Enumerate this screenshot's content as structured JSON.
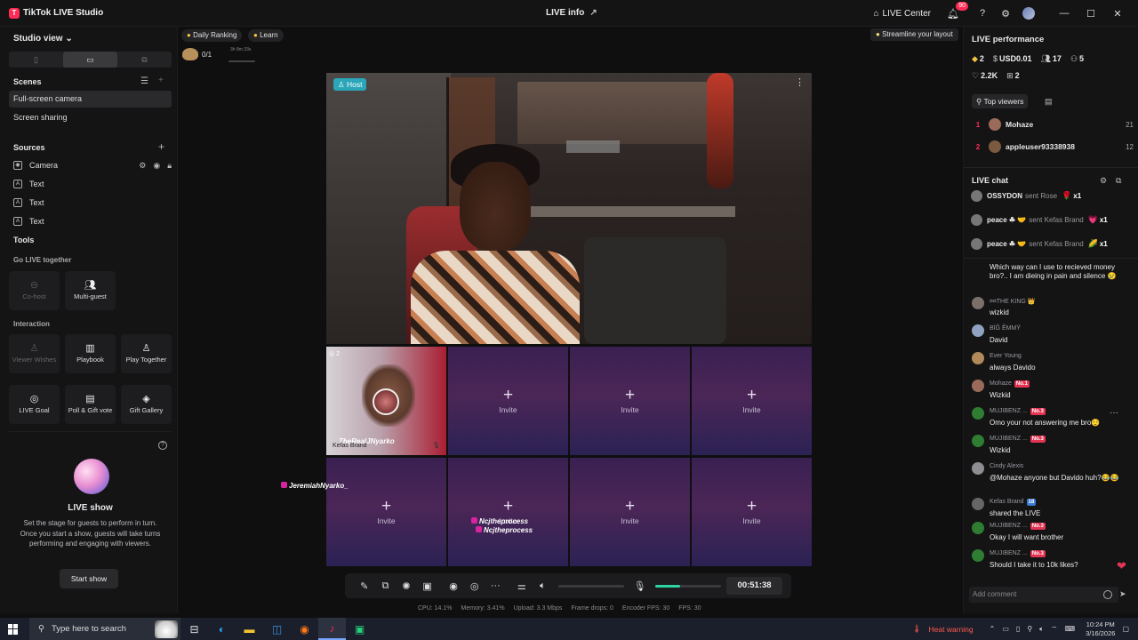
{
  "app": {
    "name": "TikTok LIVE Studio",
    "logo": "T"
  },
  "titlebar": {
    "center": "LIVE info",
    "live_center": "LIVE Center",
    "notif_count": "90"
  },
  "left": {
    "studio_view": "Studio view",
    "scenes_title": "Scenes",
    "scenes": [
      "Full-screen camera",
      "Screen sharing"
    ],
    "sources_title": "Sources",
    "sources": [
      "Camera",
      "Text",
      "Text",
      "Text"
    ],
    "tools_title": "Tools",
    "go_live_title": "Go LIVE together",
    "cohost": "Co-host",
    "multiguest": "Multi-guest",
    "interaction_title": "Interaction",
    "viewer_wishes": "Viewer Wishes",
    "playbook": "Playbook",
    "play_together": "Play Together",
    "live_goal": "LIVE Goal",
    "poll": "Poll & Gift vote",
    "gift_gallery": "Gift Gallery",
    "liveshow_title": "LIVE show",
    "liveshow_desc": "Set the stage for guests to perform in turn. Once you start a show, guests will take turns performing and engaging with viewers.",
    "start_show": "Start show"
  },
  "center": {
    "daily_ranking": "Daily Ranking",
    "learn": "Learn",
    "rank_value": "0/1",
    "rank_time": "3h 8m 33s",
    "streamline": "Streamline your layout",
    "host_tag": "Host",
    "guest_count": "2",
    "guest_name1": "TheRealJNyarko",
    "guest_name2": "Kefas Brand",
    "overlay_left": "JeremiahNyarko_",
    "overlay_mid1": "Ncjtheprocess",
    "overlay_mid2": "Ncjtheprocess",
    "invite": "Invite",
    "timer": "00:51:38",
    "mic_level": 0.38,
    "stats": {
      "cpu": "CPU: 14.1%",
      "memory": "Memory: 3.41%",
      "upload": "Upload: 3.3 Mbps",
      "drops": "Frame drops: 0",
      "enc": "Encoder FPS: 30",
      "fps": "FPS: 30"
    }
  },
  "right": {
    "perf_title": "LIVE performance",
    "diamonds": "2",
    "usd": "USD0.01",
    "viewers": "17",
    "new_followers": "5",
    "likes": "2.2K",
    "gifts": "2",
    "top_viewers": "Top viewers",
    "top_list": [
      {
        "rank": "1",
        "name": "Mohaze",
        "count": "21",
        "color": "#9a6b5a"
      },
      {
        "rank": "2",
        "name": "appleuser93338938",
        "count": "12",
        "color": "#7a5a40"
      }
    ],
    "chat_title": "LIVE chat",
    "gifts_list": [
      {
        "user": "OSSYDON",
        "text": "sent Rose",
        "icon": "🌹",
        "mult": "x1"
      },
      {
        "user": "peace ☘ 🤝",
        "text": "sent Kefas Brand",
        "icon": "💗",
        "mult": "x1"
      },
      {
        "user": "peace ☘ 🤝",
        "text": "sent Kefas Brand",
        "icon": "🌽",
        "mult": "x1"
      }
    ],
    "partial_msg": "Which way can I use to recieved money bro?.. I am dieing in pain and silence 😢",
    "messages": [
      {
        "user": "¤¤THE KING 👑",
        "lv": "",
        "text": "wizkid",
        "color": "#7b6f6a"
      },
      {
        "user": "BÏĜ ĚMMŸ",
        "lv": "",
        "text": "David",
        "color": "#8fa3c0"
      },
      {
        "user": "Ever Young",
        "lv": "",
        "text": "always Davido",
        "color": "#b08a5a"
      },
      {
        "user": "Mohaze",
        "lv": "No.1",
        "text": "Wizkid",
        "color": "#9a6b5a"
      },
      {
        "user": "MUJIBENZ ...",
        "lv": "No.3",
        "text": "Omo your not answering me bro😌",
        "color": "#2e7d32"
      },
      {
        "user": "MUJIBENZ ...",
        "lv": "No.3",
        "text": "Wizkid",
        "color": "#2e7d32"
      },
      {
        "user": "Cindy Alexis",
        "lv": "",
        "text": "@Mohaze anyone but Davido huh?😂😂",
        "color": "#8d8d92"
      },
      {
        "user": "Kefas Brand",
        "lv": "18",
        "text": "shared the LIVE",
        "color": "#666"
      },
      {
        "user": "MUJIBENZ ...",
        "lv": "No.3",
        "text": "Okay I will want brother",
        "color": "#2e7d32"
      },
      {
        "user": "MUJIBENZ ...",
        "lv": "No.3",
        "text": "Should I take it to 10k likes?",
        "color": "#2e7d32"
      }
    ],
    "add_comment": "Add comment"
  },
  "taskbar": {
    "search": "Type here to search",
    "heat": "Heat warning",
    "time": "10:24 PM",
    "date": "3/16/2026"
  }
}
